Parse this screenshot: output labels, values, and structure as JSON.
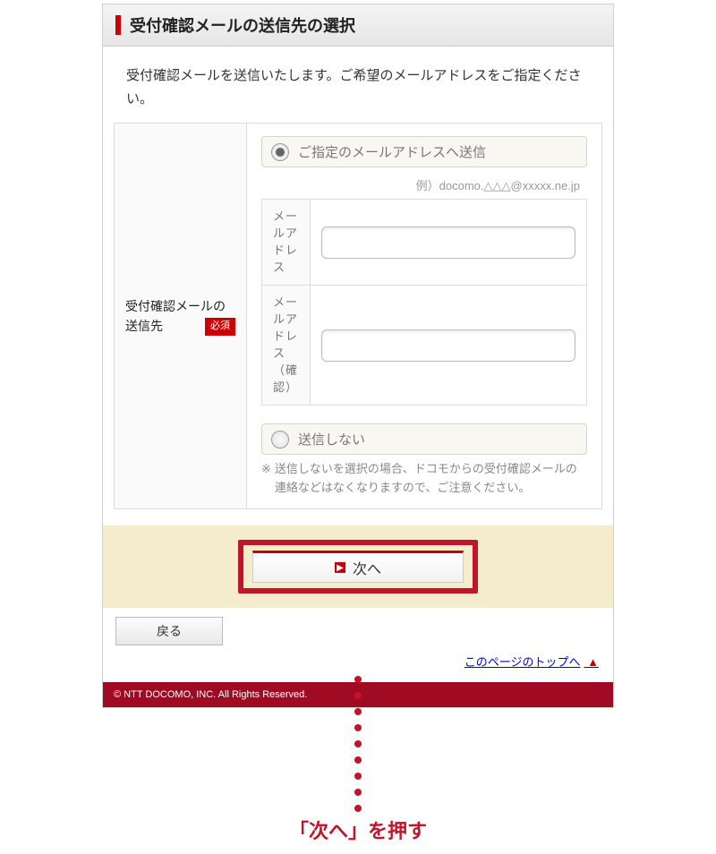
{
  "section": {
    "title": "受付確認メールの送信先の選択"
  },
  "intro": "受付確認メールを送信いたします。ご希望のメールアドレスをご指定ください。",
  "form": {
    "field_label": "受付確認メールの送信先",
    "required_badge": "必須",
    "option_send": "ご指定のメールアドレスへ送信",
    "example": "例）docomo.△△△@xxxxx.ne.jp",
    "label_mail": "メールアドレス",
    "label_mail_confirm": "メールアドレス（確認）",
    "mail_value": "",
    "mail_confirm_value": "",
    "option_nosend": "送信しない",
    "note_mark": "※",
    "note_text": "送信しないを選択の場合、ドコモからの受付確認メールの連絡などはなくなりますので、ご注意ください。"
  },
  "buttons": {
    "next": "次へ",
    "back": "戻る"
  },
  "links": {
    "page_top": "このページのトップへ"
  },
  "footer": "© NTT DOCOMO, INC. All Rights Reserved.",
  "callout": "「次へ」を押す"
}
